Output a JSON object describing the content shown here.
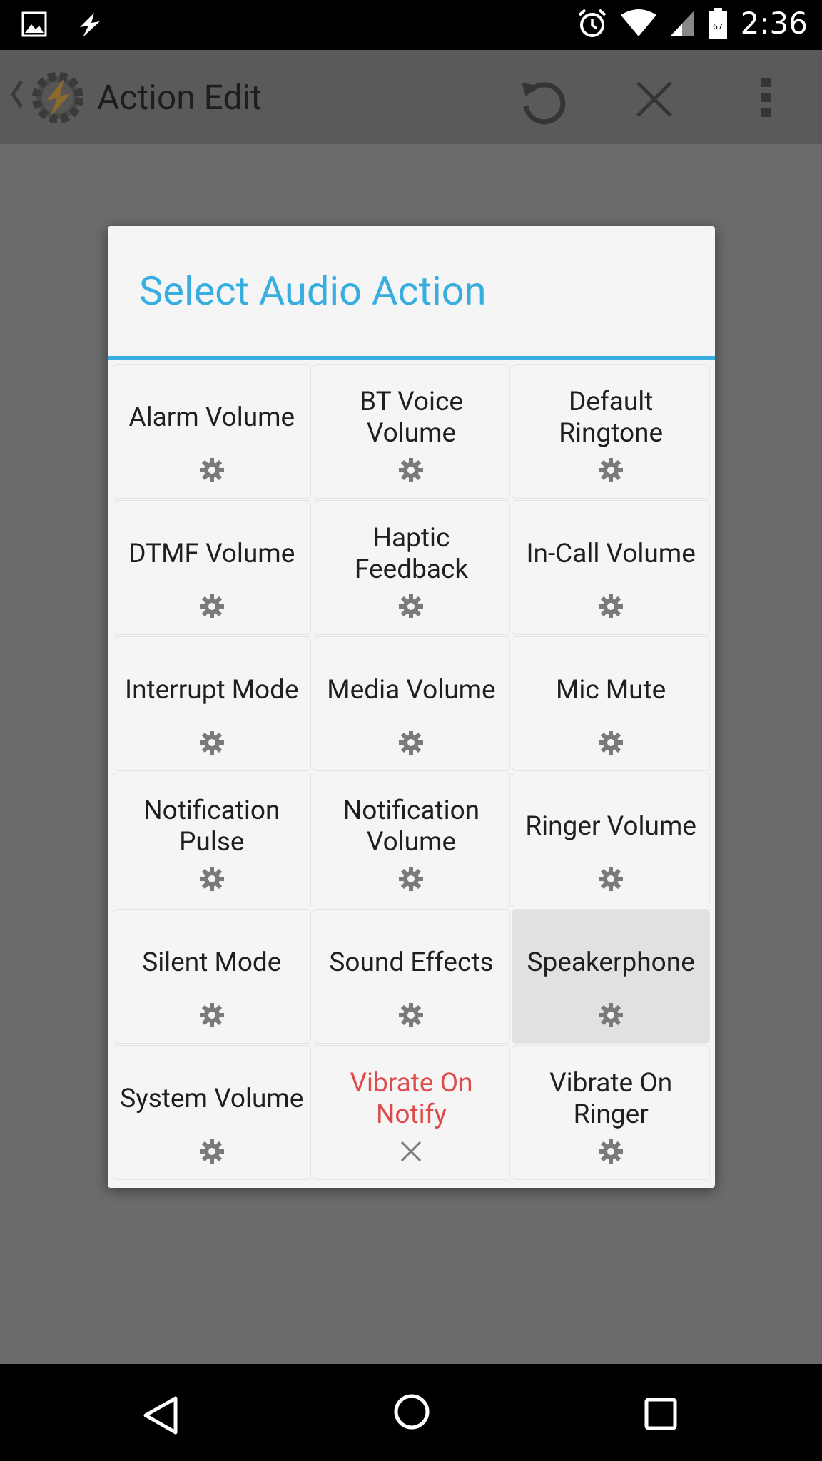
{
  "statusbar": {
    "time": "2:36",
    "battery_level": "67",
    "left_icons": [
      "image-icon",
      "tasker-flash-icon"
    ],
    "right_icons": [
      "alarm-icon",
      "wifi-icon",
      "signal-icon",
      "battery-icon"
    ]
  },
  "actionbar": {
    "title": "Action Edit",
    "icons": [
      "back-caret-icon",
      "tasker-logo-icon",
      "undo-icon",
      "close-icon",
      "overflow-menu-icon"
    ]
  },
  "dialog": {
    "title": "Select Audio Action",
    "accent_color": "#38aee0",
    "items": [
      {
        "label": "Alarm Volume",
        "icon": "gear-icon",
        "state": "normal"
      },
      {
        "label": "BT Voice Volume",
        "icon": "gear-icon",
        "state": "normal"
      },
      {
        "label": "Default Ringtone",
        "icon": "gear-icon",
        "state": "normal"
      },
      {
        "label": "DTMF Volume",
        "icon": "gear-icon",
        "state": "normal"
      },
      {
        "label": "Haptic Feedback",
        "icon": "gear-icon",
        "state": "normal"
      },
      {
        "label": "In-Call Volume",
        "icon": "gear-icon",
        "state": "normal"
      },
      {
        "label": "Interrupt Mode",
        "icon": "gear-icon",
        "state": "normal"
      },
      {
        "label": "Media Volume",
        "icon": "gear-icon",
        "state": "normal"
      },
      {
        "label": "Mic Mute",
        "icon": "gear-icon",
        "state": "normal"
      },
      {
        "label": "Notification Pulse",
        "icon": "gear-icon",
        "state": "normal"
      },
      {
        "label": "Notification Volume",
        "icon": "gear-icon",
        "state": "normal"
      },
      {
        "label": "Ringer Volume",
        "icon": "gear-icon",
        "state": "normal"
      },
      {
        "label": "Silent Mode",
        "icon": "gear-icon",
        "state": "normal"
      },
      {
        "label": "Sound Effects",
        "icon": "gear-icon",
        "state": "normal"
      },
      {
        "label": "Speakerphone",
        "icon": "gear-icon",
        "state": "pressed"
      },
      {
        "label": "System Volume",
        "icon": "gear-icon",
        "state": "normal"
      },
      {
        "label": "Vibrate On Notify",
        "icon": "x-icon",
        "state": "unavailable"
      },
      {
        "label": "Vibrate On Ringer",
        "icon": "gear-icon",
        "state": "normal"
      }
    ],
    "unavailable_color": "#dd4b4b"
  },
  "navbar": {
    "icons": [
      "nav-back-icon",
      "nav-home-icon",
      "nav-recents-icon"
    ]
  }
}
